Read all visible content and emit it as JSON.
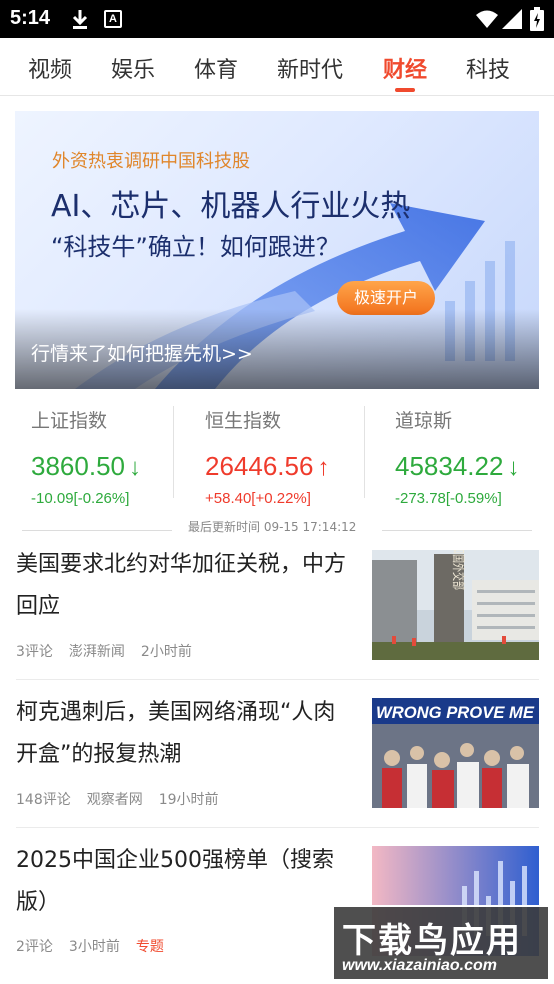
{
  "status_bar": {
    "time": "5:14",
    "notification_badge": "A"
  },
  "tabs": [
    {
      "label": "视频",
      "active": false
    },
    {
      "label": "娱乐",
      "active": false
    },
    {
      "label": "体育",
      "active": false
    },
    {
      "label": "新时代",
      "active": false
    },
    {
      "label": "财经",
      "active": true
    },
    {
      "label": "科技",
      "active": false
    }
  ],
  "banner": {
    "kicker": "外资热衷调研中国科技股",
    "headline": "AI、芯片、机器人行业火热",
    "subhead": "“科技牛”确立！如何跟进？",
    "cta": "极速开户",
    "caption": "行情来了如何把握先机>>"
  },
  "indices": [
    {
      "name": "上证指数",
      "value": "3860.50",
      "change": "-10.09[-0.26%]",
      "direction": "down"
    },
    {
      "name": "恒生指数",
      "value": "26446.56",
      "change": "+58.40[+0.22%]",
      "direction": "up"
    },
    {
      "name": "道琼斯",
      "value": "45834.22",
      "change": "-273.78[-0.59%]",
      "direction": "down"
    }
  ],
  "last_updated": "最后更新时间 09-15 17:14:12",
  "news": [
    {
      "title": "美国要求北约对华加征关税，中方回应",
      "comments": "3评论",
      "source": "澎湃新闻",
      "time": "2小时前",
      "tag": ""
    },
    {
      "title": "柯克遇刺后，美国网络涌现“人肉开盒”的报复热潮",
      "comments": "148评论",
      "source": "观察者网",
      "time": "19小时前",
      "tag": ""
    },
    {
      "title": "2025中国企业500强榜单（搜索版）",
      "comments": "2评论",
      "source": "",
      "time": "3小时前",
      "tag": "专题"
    }
  ],
  "thumb_text": {
    "ministry_sign": "中华人民共和国外交部",
    "protest_banner": "WRONG PROVE ME"
  },
  "watermark": {
    "brand": "下载鸟应用",
    "url": "www.xiazainiao.com"
  },
  "colors": {
    "accent": "#f04a2e",
    "down": "#2eaa3d",
    "up": "#ef3b2c"
  }
}
